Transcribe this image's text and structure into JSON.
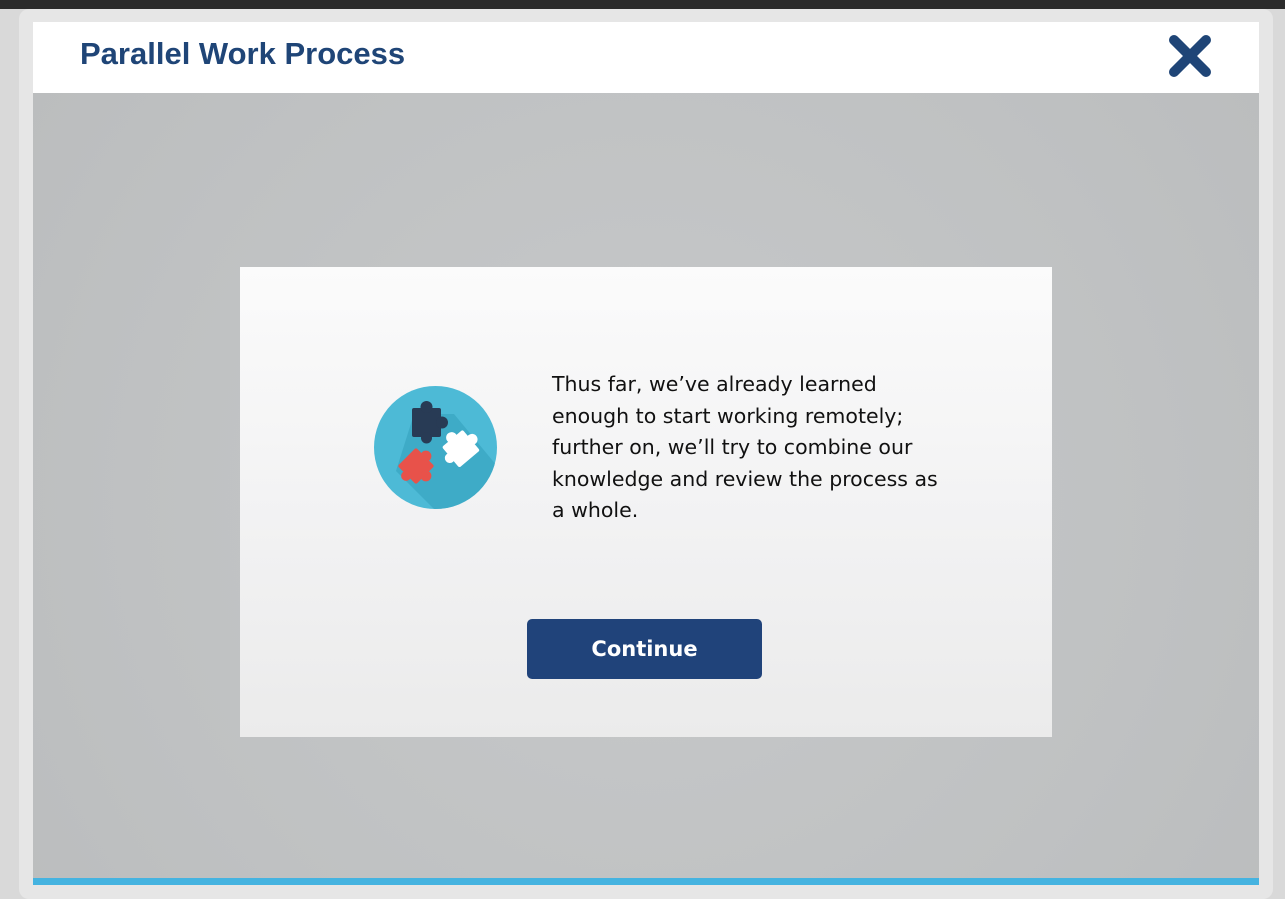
{
  "header": {
    "title": "Parallel Work Process",
    "close_icon": "close-icon",
    "title_color": "#1f4577"
  },
  "dialog": {
    "icon": "puzzle-pieces-icon",
    "message": "Thus far, we’ve already learned enough to start working remotely; further on, we’ll try to combine our knowledge and review the process as a whole.",
    "continue_label": "Continue",
    "button_color": "#20437a"
  },
  "theme": {
    "accent_bar": "#45b3e0",
    "icon_circle": "#4dbad6",
    "puzzle_dark": "#283b55",
    "puzzle_red": "#e8524a",
    "puzzle_white": "#ffffff"
  }
}
